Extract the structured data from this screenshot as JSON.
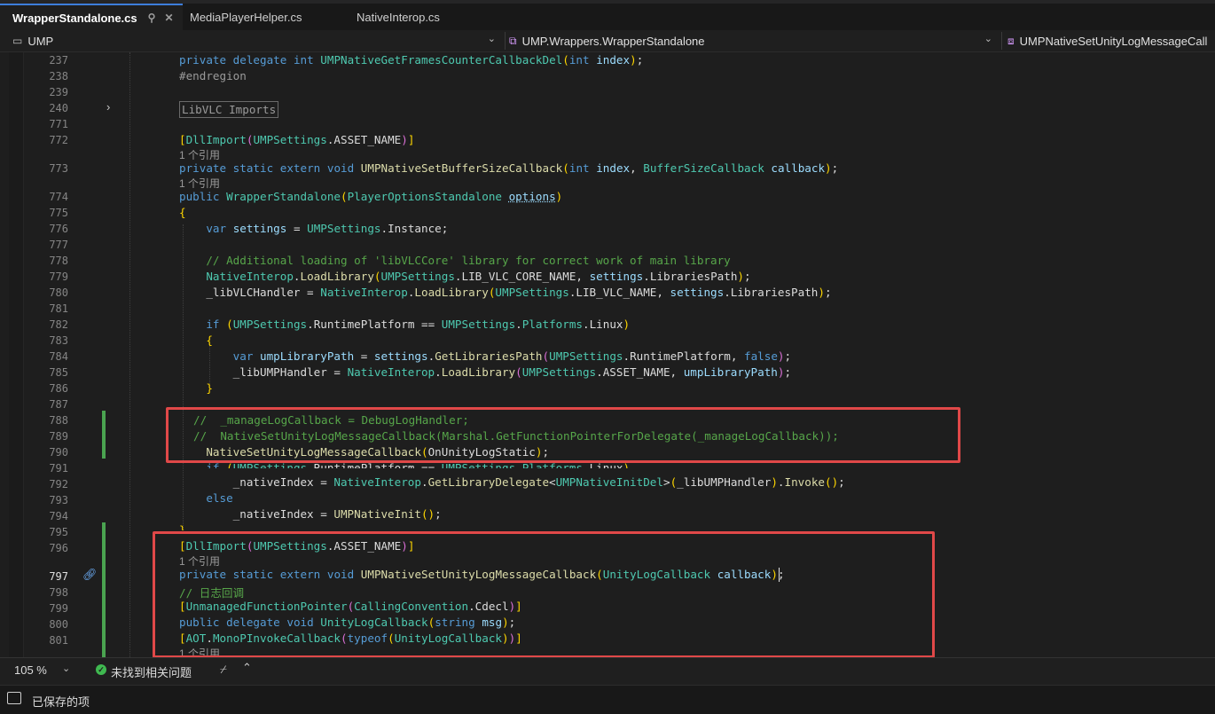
{
  "tabs": [
    {
      "label": "WrapperStandalone.cs",
      "active": true
    },
    {
      "label": "MediaPlayerHelper.cs",
      "active": false
    },
    {
      "label": "NativeInterop.cs",
      "active": false
    }
  ],
  "nav": {
    "project": "UMP",
    "class": "UMP.Wrappers.WrapperStandalone",
    "member": "UMPNativeSetUnityLogMessageCall"
  },
  "editor": {
    "lines": [
      "237",
      "238",
      "239",
      "240",
      "771",
      "772",
      "",
      "773",
      "",
      "774",
      "775",
      "776",
      "777",
      "778",
      "779",
      "780",
      "781",
      "782",
      "783",
      "784",
      "785",
      "786",
      "787",
      "788",
      "789",
      "790",
      "791",
      "792",
      "793",
      "794",
      "795",
      "796",
      "",
      "797",
      "798",
      "799",
      "800",
      "801"
    ],
    "current_line": "797",
    "region_label": "LibVLC Imports",
    "refs": {
      "r1": "1 个引用",
      "r2": "1 个引用",
      "r3": "1 个引用",
      "r4": "1 个引用"
    }
  },
  "colors": {
    "accent": "#3d7ddb",
    "highlight_box": "#e04848",
    "change_marker": "#4aa350"
  },
  "status": {
    "zoom": "105 %",
    "issues": "未找到相关问题",
    "saved": "已保存的项"
  }
}
